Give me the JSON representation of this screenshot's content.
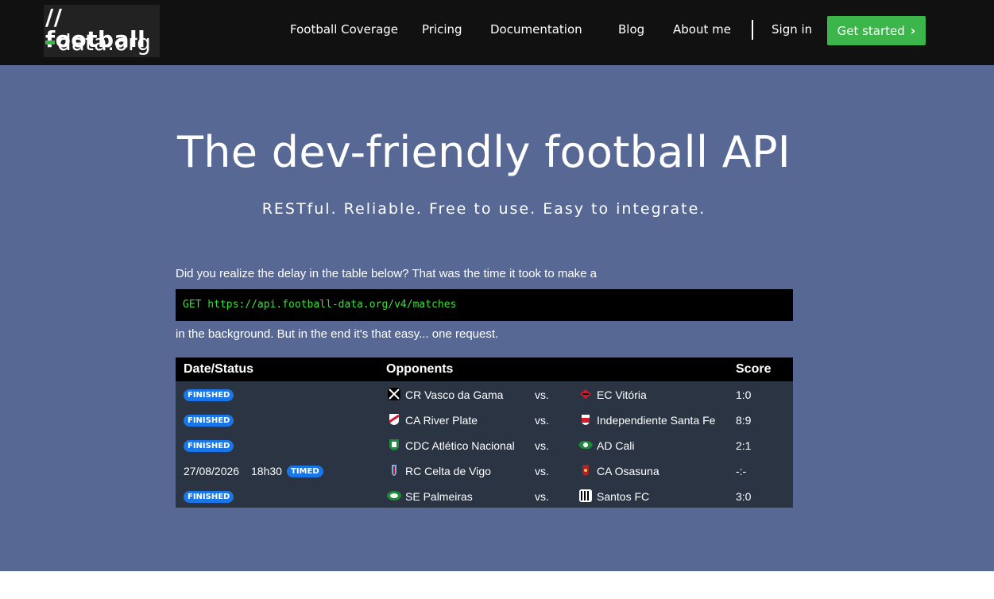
{
  "brand": {
    "line1": "// football",
    "line2": "data.org"
  },
  "nav": {
    "items": [
      "Football Coverage",
      "Pricing",
      "Documentation",
      "Blog",
      "About me"
    ],
    "signin": "Sign in",
    "cta": "Get started"
  },
  "hero": {
    "title": "The dev-friendly football API",
    "tagline": "RESTful. Reliable. Free to use. Easy to integrate.",
    "intro": "Did you realize the delay in the table below? That was the time it took to make a",
    "code": "GET https://api.football-data.org/v4/matches",
    "outro": "in the background. But in the end it's that easy... one request."
  },
  "matches": {
    "headers": {
      "date": "Date/Status",
      "opponents": "Opponents",
      "score": "Score"
    },
    "vs": "vs.",
    "rows": [
      {
        "status": "FINISHED",
        "date": "",
        "time": "",
        "home": "CR Vasco da Gama",
        "away": "EC Vitória",
        "score": "1:0",
        "home_color": "#000000",
        "away_color": "#d11a2a"
      },
      {
        "status": "FINISHED",
        "date": "",
        "time": "",
        "home": "CA River Plate",
        "away": "Independiente Santa Fe",
        "score": "8:9",
        "home_color": "#d11a2a",
        "away_color": "#d11a2a"
      },
      {
        "status": "FINISHED",
        "date": "",
        "time": "",
        "home": "CDC Atlético Nacional",
        "away": "AD Cali",
        "score": "2:1",
        "home_color": "#1e8a3a",
        "away_color": "#1e8a3a"
      },
      {
        "status": "TIMED",
        "date": "27/08/2026",
        "time": "18h30",
        "home": "RC Celta de Vigo",
        "away": "CA Osasuna",
        "score": "-:-",
        "home_color": "#7ab0e0",
        "away_color": "#b0202a"
      },
      {
        "status": "FINISHED",
        "date": "",
        "time": "",
        "home": "SE Palmeiras",
        "away": "Santos FC",
        "score": "3:0",
        "home_color": "#1e8a3a",
        "away_color": "#000000"
      }
    ]
  },
  "colors": {
    "accent": "#3cb54a",
    "hero_bg": "#576894",
    "badge": "#1976e8",
    "code_text": "#39e03a"
  }
}
